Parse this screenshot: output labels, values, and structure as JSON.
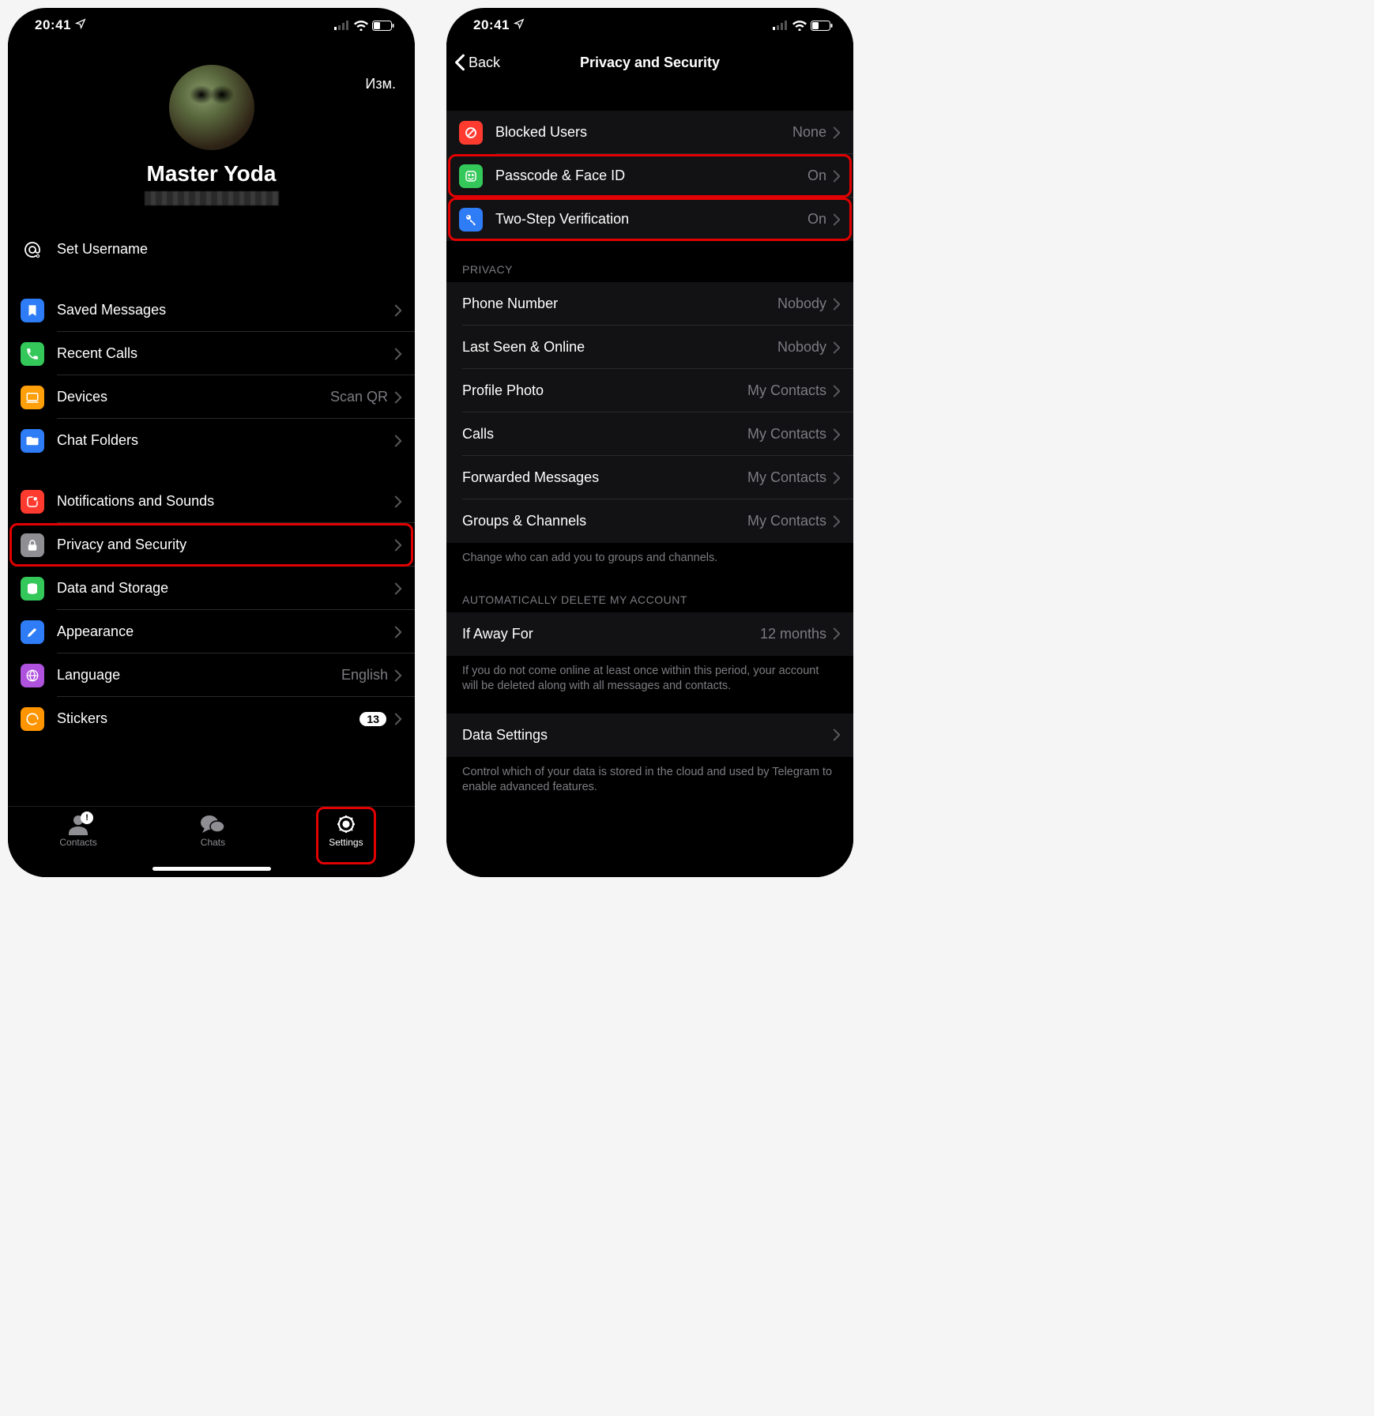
{
  "statusbar": {
    "time": "20:41"
  },
  "left": {
    "edit": "Изм.",
    "profile": {
      "name": "Master Yoda"
    },
    "username_row": {
      "label": "Set Username"
    },
    "group_a": [
      {
        "key": "saved",
        "label": "Saved Messages",
        "color": "#2e7cf6",
        "value": ""
      },
      {
        "key": "calls",
        "label": "Recent Calls",
        "color": "#34c759",
        "value": ""
      },
      {
        "key": "devices",
        "label": "Devices",
        "color": "#ff9f0a",
        "value": "Scan QR"
      },
      {
        "key": "folders",
        "label": "Chat Folders",
        "color": "#2e7cf6",
        "value": ""
      }
    ],
    "group_b": [
      {
        "key": "notifications",
        "label": "Notifications and Sounds",
        "color": "#ff3b30",
        "value": ""
      },
      {
        "key": "privacy",
        "label": "Privacy and Security",
        "color": "#8e8e93",
        "value": "",
        "highlight": true
      },
      {
        "key": "data",
        "label": "Data and Storage",
        "color": "#34c759",
        "value": ""
      },
      {
        "key": "appearance",
        "label": "Appearance",
        "color": "#2e7cf6",
        "value": ""
      },
      {
        "key": "language",
        "label": "Language",
        "color": "#af52de",
        "value": "English"
      },
      {
        "key": "stickers",
        "label": "Stickers",
        "color": "#ff9500",
        "badge": "13"
      }
    ],
    "tabs": {
      "contacts": "Contacts",
      "chats": "Chats",
      "settings": "Settings"
    }
  },
  "right": {
    "back": "Back",
    "title": "Privacy and Security",
    "security": [
      {
        "key": "blocked",
        "label": "Blocked Users",
        "value": "None",
        "color": "#ff3b30"
      },
      {
        "key": "passcode",
        "label": "Passcode & Face ID",
        "value": "On",
        "color": "#34c759",
        "highlight": true
      },
      {
        "key": "twostep",
        "label": "Two-Step Verification",
        "value": "On",
        "color": "#2e7cf6",
        "highlight": true
      }
    ],
    "privacy_header": "PRIVACY",
    "privacy": [
      {
        "key": "phone",
        "label": "Phone Number",
        "value": "Nobody"
      },
      {
        "key": "lastseen",
        "label": "Last Seen & Online",
        "value": "Nobody"
      },
      {
        "key": "photo",
        "label": "Profile Photo",
        "value": "My Contacts"
      },
      {
        "key": "pcalls",
        "label": "Calls",
        "value": "My Contacts"
      },
      {
        "key": "fwd",
        "label": "Forwarded Messages",
        "value": "My Contacts"
      },
      {
        "key": "groups",
        "label": "Groups & Channels",
        "value": "My Contacts"
      }
    ],
    "privacy_footer": "Change who can add you to groups and channels.",
    "autodel_header": "AUTOMATICALLY DELETE MY ACCOUNT",
    "autodel": {
      "label": "If Away For",
      "value": "12 months"
    },
    "autodel_footer": "If you do not come online at least once within this period, your account will be deleted along with all messages and contacts.",
    "datasettings": {
      "label": "Data Settings"
    },
    "datasettings_footer": "Control which of your data is stored in the cloud and used by Telegram to enable advanced features."
  }
}
